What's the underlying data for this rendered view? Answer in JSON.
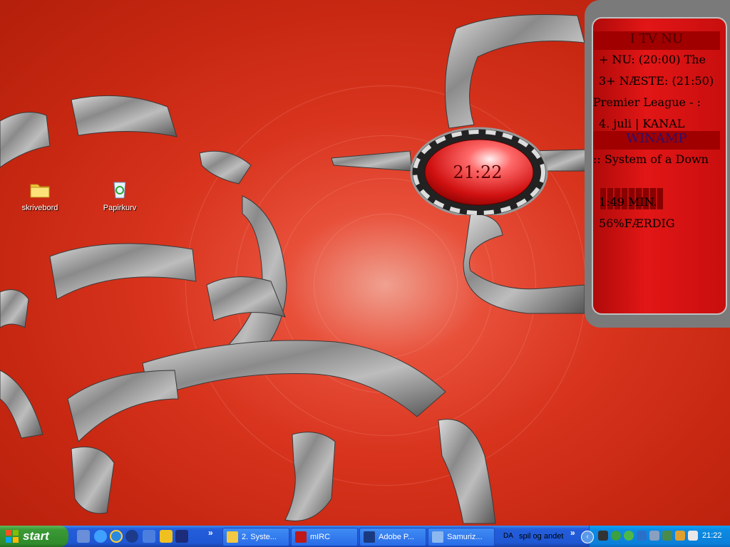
{
  "desktop": {
    "icons": [
      {
        "label": "skrivebord"
      },
      {
        "label": "Papirkurv"
      }
    ]
  },
  "clock": {
    "time": "21:22"
  },
  "widget": {
    "tv_header": "I TV NU",
    "tv_lines": [
      "+ NU:  (20:00) The",
      "3+ NÆSTE: (21:50)",
      "Premier League - :",
      "4. juli | KANAL"
    ],
    "winamp_header": "WINAMP",
    "track": ":: System of a Down",
    "time_label": "1:49 MIN.",
    "progress_label": "56%FÆRDIG",
    "progress_value": 0.56
  },
  "taskbar": {
    "start_label": "start",
    "more_chevron": "»",
    "tasks": [
      {
        "label": "2. Syste..."
      },
      {
        "label": "mIRC"
      },
      {
        "label": "Adobe P..."
      },
      {
        "label": "Samuriz..."
      },
      {
        "label": "spil og andet"
      }
    ],
    "toolbar_prefix": "DA",
    "tray_time": "21:22",
    "colors": {
      "taskbar": "#245edb",
      "start": "#3a9a36",
      "tray": "#0b7fd9"
    }
  }
}
